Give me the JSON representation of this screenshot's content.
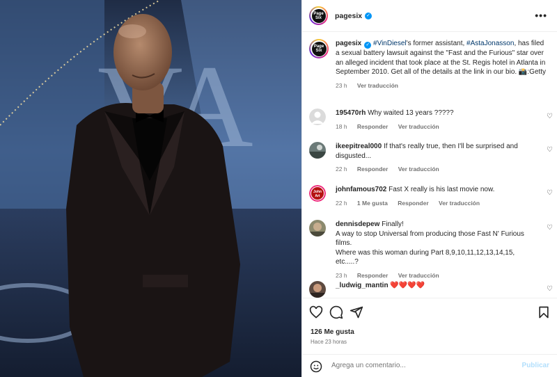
{
  "post": {
    "username": "pagesix",
    "avatar_text_top": "Page",
    "avatar_text_bottom": "Six",
    "more_icon": "more-horizontal-icon"
  },
  "caption": {
    "username": "pagesix",
    "tag1": "#VinDiesel",
    "text1": "'s former assistant, ",
    "tag2": "#AstaJonasson",
    "text2": ", has filed a sexual battery lawsuit against the \"Fast and the Furious\" star over an alleged incident that took place at the St. Regis hotel in Atlanta in September 2010. Get all of the details at the link in our bio. 📸:Getty",
    "time": "23 h",
    "translate": "Ver traducción"
  },
  "comments": [
    {
      "username": "195470rh",
      "text": "Why waited 13 years ?????",
      "time": "18 h",
      "likes": "",
      "reply": "Responder",
      "translate": "Ver traducción"
    },
    {
      "username": "ikeepitreal000",
      "text": "If that's really true, then I'll be surprised and disgusted...",
      "time": "22 h",
      "likes": "",
      "reply": "Responder",
      "translate": "Ver traducción"
    },
    {
      "username": "johnfamous702",
      "text": "Fast X really is his last movie now.",
      "time": "22 h",
      "likes": "1 Me gusta",
      "reply": "Responder",
      "translate": "Ver traducción"
    },
    {
      "username": "dennisdepew",
      "text": "Finally!\nA way to stop Universal from producing those Fast N' Furious films.\nWhere was this woman during Part 8,9,10,11,12,13,14,15, etc.....?",
      "time": "23 h",
      "likes": "",
      "reply": "Responder",
      "translate": "Ver traducción"
    },
    {
      "username": "_ludwig_mantin",
      "text": "❤️❤️❤️❤️",
      "time": "",
      "likes": "",
      "reply": "",
      "translate": ""
    }
  ],
  "footer": {
    "likes": "126 Me gusta",
    "when": "Hace 23 horas",
    "comment_placeholder": "Agrega un comentario...",
    "publish": "Publicar"
  },
  "colors": {
    "link": "#00376b",
    "verified": "#0095f6",
    "muted": "#737373",
    "publish_disabled": "#b2dffc"
  }
}
